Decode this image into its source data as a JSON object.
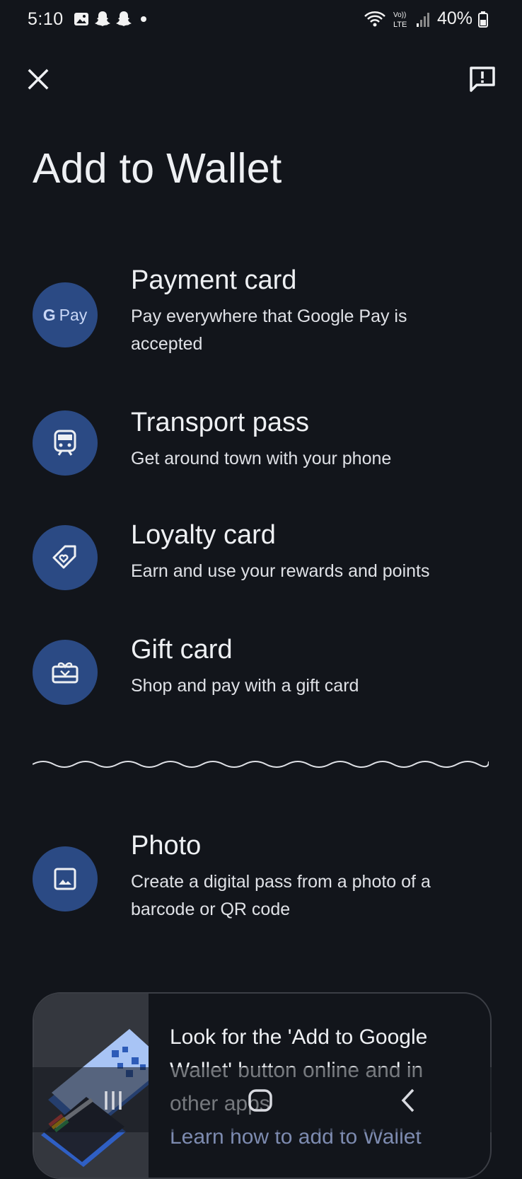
{
  "status_bar": {
    "time": "5:10",
    "notification_icons": [
      "gallery-icon",
      "snapchat-icon",
      "snapchat-icon",
      "dot-icon"
    ],
    "network_label": "Vo)) LTE",
    "battery": "40%"
  },
  "header": {
    "close_icon": "close-icon",
    "feedback_icon": "feedback-icon"
  },
  "page": {
    "title": "Add to Wallet"
  },
  "options": [
    {
      "title": "Payment card",
      "description": "Pay everywhere that Google Pay is accepted",
      "icon": "google-pay-icon",
      "logo_g": "G",
      "logo_text": "Pay"
    },
    {
      "title": "Transport pass",
      "description": "Get around town with your phone",
      "icon": "train-icon"
    },
    {
      "title": "Loyalty card",
      "description": "Earn and use your rewards and points",
      "icon": "tag-heart-icon"
    },
    {
      "title": "Gift card",
      "description": "Shop and pay with a gift card",
      "icon": "gift-card-icon"
    },
    {
      "title": "Photo",
      "description": "Create a digital pass from a photo of a barcode or QR code",
      "icon": "image-icon"
    }
  ],
  "promo": {
    "text": "Look for the 'Add to Google Wallet' button online and in other apps",
    "faded_text": "Learn how to add to Wallet"
  },
  "colors": {
    "background": "#12151b",
    "icon_circle": "#2b4a84",
    "text_primary": "#eef0f3"
  }
}
